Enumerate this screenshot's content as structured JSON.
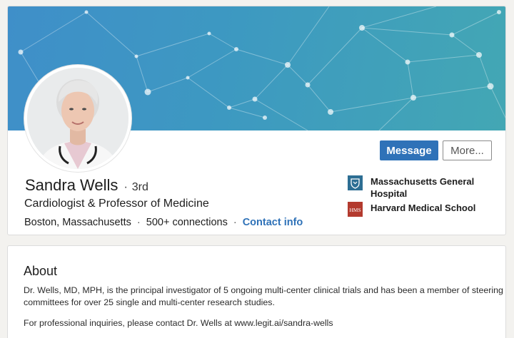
{
  "profile": {
    "name": "Sandra Wells",
    "connection_degree": "3rd",
    "headline": "Cardiologist & Professor of Medicine",
    "location": "Boston, Massachusetts",
    "connections": "500+ connections",
    "contact_info_label": "Contact info"
  },
  "actions": {
    "message_label": "Message",
    "more_label": "More..."
  },
  "organizations": [
    {
      "name": "Massachusetts General Hospital",
      "icon": "hospital-logo-icon",
      "color": "#2d6e93"
    },
    {
      "name": "Harvard Medical School",
      "icon": "hms-logo-icon",
      "logo_text": "HMS",
      "color": "#b33a2e"
    }
  ],
  "about": {
    "title": "About",
    "paragraph_1": "Dr. Wells, MD, MPH, is the principal investigator of 5 ongoing multi-center clinical trials and has been a member of steering committees for over 25 single and multi-center research studies.",
    "paragraph_2": "For professional inquiries, please contact Dr. Wells at www.legit.ai/sandra-wells"
  },
  "colors": {
    "accent": "#2f72b8",
    "banner_start": "#3f8fc9",
    "banner_end": "#43a7b4"
  }
}
